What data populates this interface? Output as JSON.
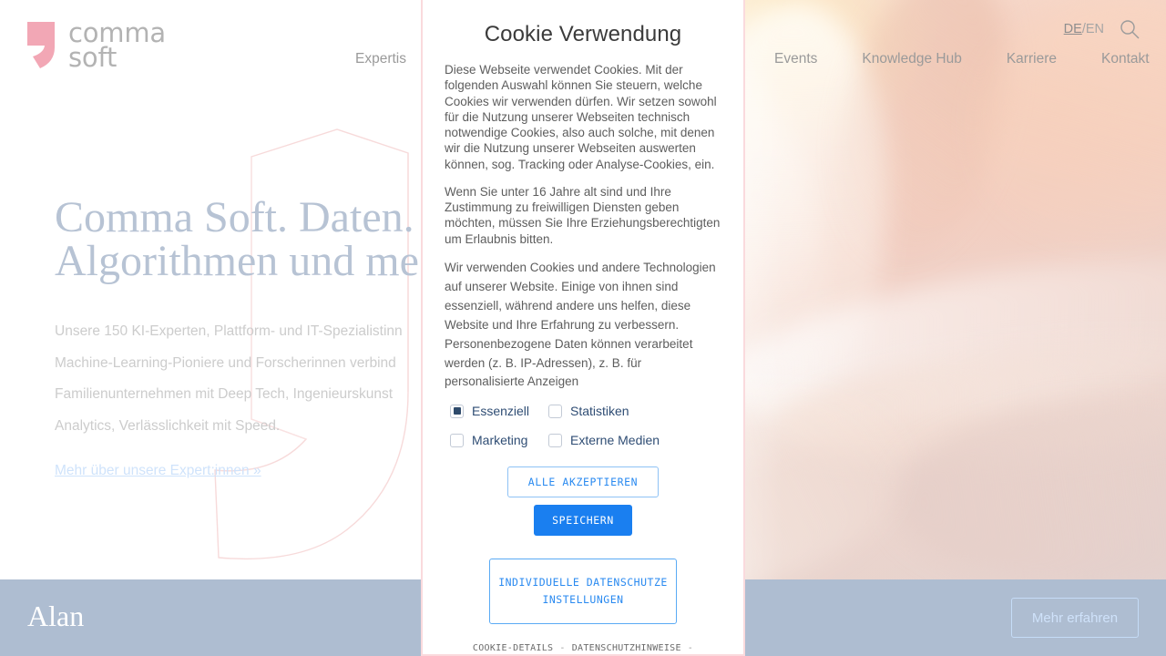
{
  "header": {
    "logo_line1": "comma",
    "logo_line2": "soft",
    "nav_items": [
      {
        "label": "Expertis",
        "name": "nav-expertise"
      },
      {
        "label": "Events",
        "name": "nav-events"
      },
      {
        "label": "Knowledge Hub",
        "name": "nav-knowledge-hub"
      },
      {
        "label": "Karriere",
        "name": "nav-karriere"
      },
      {
        "label": "Kontakt",
        "name": "nav-kontakt"
      }
    ],
    "lang_active": "DE",
    "lang_sep": "/",
    "lang_other": "EN",
    "search_icon": "search-icon"
  },
  "hero": {
    "title_line1": "Comma Soft. Daten.",
    "title_line2": "Algorithmen und me",
    "paragraph_line1": "Unsere 150 KI-Experten, Plattform- und IT-Spezialistinn",
    "paragraph_line2": "Machine-Learning-Pioniere und Forscherinnen verbind",
    "paragraph_line3": "Familienunternehmen mit Deep Tech, Ingenieurskunst",
    "paragraph_line4": "Analytics, Verlässlichkeit mit Speed.",
    "link_label": "Mehr über unsere Expert:innen »"
  },
  "bottom_bar": {
    "title": "Alan",
    "button_label": "Mehr erfahren"
  },
  "cookie_modal": {
    "title": "Cookie Verwendung",
    "paragraph_1": "Diese Webseite verwendet Cookies. Mit der folgenden Auswahl können Sie steuern, welche Cookies wir verwenden dürfen. Wir setzen sowohl für die Nutzung unserer Webseiten technisch notwendige Cookies, also auch solche, mit denen wir die Nutzung unserer Webseiten auswerten können, sog. Tracking oder Analyse-Cookies, ein.",
    "paragraph_2": "Wenn Sie unter 16 Jahre alt sind und Ihre Zustimmung zu freiwilligen Diensten geben möchten, müssen Sie Ihre Erziehungsberechtigten um Erlaubnis bitten.",
    "paragraph_3": "Wir verwenden Cookies und andere Technologien auf unserer Website. Einige von ihnen sind essenziell, während andere uns helfen, diese Website und Ihre Erfahrung zu verbessern. Personenbezogene Daten können verarbeitet werden (z. B. IP-Adressen), z. B. für personalisierte Anzeigen",
    "checkboxes": [
      {
        "label": "Essenziell",
        "checked": true,
        "name": "checkbox-essenziell"
      },
      {
        "label": "Statistiken",
        "checked": false,
        "name": "checkbox-statistiken"
      },
      {
        "label": "Marketing",
        "checked": false,
        "name": "checkbox-marketing"
      },
      {
        "label": "Externe Medien",
        "checked": false,
        "name": "checkbox-externe-medien"
      }
    ],
    "accept_all_label": "ALLE AKZEPTIEREN",
    "save_label": "SPEICHERN",
    "individual_label": "INDIVIDUELLE DATENSCHUTZEINSTELLUNGEN",
    "footer_links": [
      {
        "label": "COOKIE-DETAILS",
        "name": "link-cookie-details"
      },
      {
        "label": "DATENSCHUTZHINWEISE",
        "name": "link-datenschutzhinweise"
      }
    ],
    "footer_sep": "-"
  },
  "colors": {
    "brand_pink": "#f2a7b5",
    "logo_gray": "#b3b3b3",
    "accent_blue": "#1a7ff0",
    "accent_blue_light": "#2a8af0",
    "checkbox_navy": "#2e4a6b",
    "bottom_bar_blue": "#aebdd1",
    "hero_title_blue": "#b7c3d4",
    "modal_border_pink": "#fadadd"
  }
}
